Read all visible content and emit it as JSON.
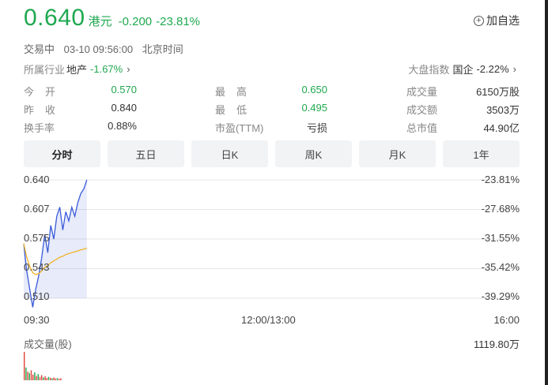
{
  "quote": {
    "price": "0.640",
    "currency": "港元",
    "change": "-0.200",
    "change_pct": "-23.81%",
    "watch_label": "加自选"
  },
  "status": {
    "state": "交易中",
    "datetime": "03-10 09:56:00",
    "timezone": "北京时间"
  },
  "industry": {
    "label": "所属行业",
    "name": "地产",
    "change": "-1.67%"
  },
  "index": {
    "label": "大盘指数",
    "name": "国企",
    "change": "-2.22%"
  },
  "stats": [
    [
      {
        "label": "今开",
        "value": "0.570",
        "color": "green"
      },
      {
        "label": "最高",
        "value": "0.650",
        "color": "green"
      },
      {
        "label": "成交量",
        "value": "6150万股",
        "color": "dark"
      }
    ],
    [
      {
        "label": "昨收",
        "value": "0.840",
        "color": "dark"
      },
      {
        "label": "最低",
        "value": "0.495",
        "color": "green"
      },
      {
        "label": "成交额",
        "value": "3503万",
        "color": "dark"
      }
    ],
    [
      {
        "label": "换手率",
        "value": "0.88%",
        "color": "dark"
      },
      {
        "label": "市盈(TTM)",
        "value": "亏损",
        "color": "dark"
      },
      {
        "label": "总市值",
        "value": "44.90亿",
        "color": "dark"
      }
    ]
  ],
  "tabs": [
    "分时",
    "五日",
    "日K",
    "周K",
    "月K",
    "1年"
  ],
  "active_tab": 0,
  "colors": {
    "down": "#1fa84f",
    "price_line": "#3a5bd9",
    "avg_line": "#f0b429",
    "vol_up": "#e0433b",
    "vol_down": "#1fa84f"
  },
  "chart_data": {
    "type": "line",
    "y_left_ticks": [
      "0.640",
      "0.607",
      "0.575",
      "0.543",
      "0.510"
    ],
    "y_right_ticks": [
      "-23.81%",
      "-27.68%",
      "-31.55%",
      "-35.42%",
      "-39.29%"
    ],
    "x_ticks": [
      "09:30",
      "12:00/13:00",
      "16:00"
    ],
    "ylim": [
      0.51,
      0.64
    ],
    "session_minutes": 330,
    "series": [
      {
        "values": [
          0.57,
          0.54,
          0.52,
          0.5,
          0.52,
          0.535,
          0.555,
          0.58,
          0.56,
          0.59,
          0.575,
          0.6,
          0.61,
          0.585,
          0.605,
          0.595,
          0.61,
          0.6,
          0.615,
          0.625,
          0.63,
          0.64
        ]
      },
      {
        "values": [
          0.57,
          0.555,
          0.545,
          0.538,
          0.536,
          0.537,
          0.54,
          0.544,
          0.546,
          0.549,
          0.551,
          0.553,
          0.555,
          0.556,
          0.558,
          0.559,
          0.56,
          0.561,
          0.562,
          0.563,
          0.564,
          0.565
        ]
      }
    ]
  },
  "volume": {
    "title": "成交量(股)",
    "max_label": "1119.80万",
    "bars": [
      {
        "v": 1.0,
        "up": true
      },
      {
        "v": 0.45,
        "up": false
      },
      {
        "v": 0.3,
        "up": true
      },
      {
        "v": 0.25,
        "up": false
      },
      {
        "v": 0.35,
        "up": true
      },
      {
        "v": 0.2,
        "up": true
      },
      {
        "v": 0.28,
        "up": false
      },
      {
        "v": 0.15,
        "up": true
      },
      {
        "v": 0.22,
        "up": false
      },
      {
        "v": 0.12,
        "up": true
      },
      {
        "v": 0.18,
        "up": true
      },
      {
        "v": 0.1,
        "up": false
      },
      {
        "v": 0.14,
        "up": true
      },
      {
        "v": 0.08,
        "up": true
      },
      {
        "v": 0.12,
        "up": false
      },
      {
        "v": 0.09,
        "up": true
      },
      {
        "v": 0.07,
        "up": false
      },
      {
        "v": 0.1,
        "up": true
      },
      {
        "v": 0.06,
        "up": true
      },
      {
        "v": 0.08,
        "up": false
      },
      {
        "v": 0.05,
        "up": true
      },
      {
        "v": 0.07,
        "up": true
      }
    ]
  }
}
